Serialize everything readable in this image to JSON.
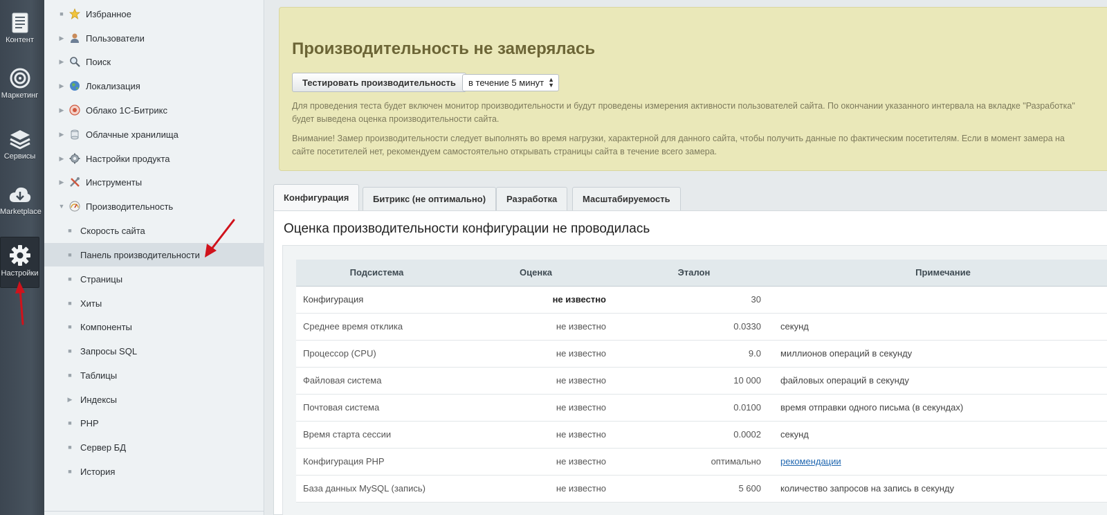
{
  "rail": {
    "items": [
      {
        "label": "Контент",
        "icon": "document-icon"
      },
      {
        "label": "Маркетинг",
        "icon": "target-icon"
      },
      {
        "label": "Сервисы",
        "icon": "layers-icon"
      },
      {
        "label": "Marketplace",
        "icon": "cloud-download-icon"
      },
      {
        "label": "Настройки",
        "icon": "gear-icon"
      }
    ]
  },
  "menu": {
    "items": [
      {
        "label": "Избранное",
        "icon": "star-icon",
        "bullet": "■"
      },
      {
        "label": "Пользователи",
        "icon": "user-icon",
        "bullet": "▶"
      },
      {
        "label": "Поиск",
        "icon": "magnifier-icon",
        "bullet": "▶"
      },
      {
        "label": "Локализация",
        "icon": "globe-icon",
        "bullet": "▶"
      },
      {
        "label": "Облако 1С-Битрикс",
        "icon": "cloud-bitrix-icon",
        "bullet": "▶"
      },
      {
        "label": "Облачные хранилища",
        "icon": "cloud-storage-icon",
        "bullet": "▶"
      },
      {
        "label": "Настройки продукта",
        "icon": "gear-small-icon",
        "bullet": "▶"
      },
      {
        "label": "Инструменты",
        "icon": "tools-icon",
        "bullet": "▶"
      },
      {
        "label": "Производительность",
        "icon": "speedometer-icon",
        "bullet": "▼"
      }
    ],
    "subitems": [
      {
        "label": "Скорость сайта",
        "bullet": "■"
      },
      {
        "label": "Панель производительности",
        "bullet": "■"
      },
      {
        "label": "Страницы",
        "bullet": "■"
      },
      {
        "label": "Хиты",
        "bullet": "■"
      },
      {
        "label": "Компоненты",
        "bullet": "■"
      },
      {
        "label": "Запросы SQL",
        "bullet": "■"
      },
      {
        "label": "Таблицы",
        "bullet": "■"
      },
      {
        "label": "Индексы",
        "bullet": "▶"
      },
      {
        "label": "PHP",
        "bullet": "■"
      },
      {
        "label": "Сервер БД",
        "bullet": "■"
      },
      {
        "label": "История",
        "bullet": "■"
      }
    ]
  },
  "alert": {
    "title": "Производительность не замерялась",
    "test_button": "Тестировать производительность",
    "period_value": "в течение 5 минут",
    "paragraph1_line1": "Для проведения теста будет включен монитор производительности и будут проведены измерения активности пользователей сайта. По окончании указанного интервала на вкладке \"Разработка\"",
    "paragraph1_line2": "будет выведена оценка производительности сайта.",
    "paragraph2_line1": "Внимание! Замер производительности следует выполнять во время нагрузки, характерной для данного сайта, чтобы получить данные по фактическим посетителям. Если в момент замера на",
    "paragraph2_line2": "сайте посетителей нет, рекомендуем самостоятельно открывать страницы сайта в течение всего замера."
  },
  "tabs": [
    {
      "label": "Конфигурация"
    },
    {
      "label": "Битрикс (не оптимально)"
    },
    {
      "label": "Разработка"
    },
    {
      "label": "Масштабируемость"
    }
  ],
  "panel": {
    "title": "Оценка производительности конфигурации не проводилась"
  },
  "table": {
    "headers": {
      "subsystem": "Подсистема",
      "score": "Оценка",
      "reference": "Эталон",
      "note": "Примечание"
    },
    "rows": [
      {
        "name": "Конфигурация",
        "score": "не известно",
        "ref": "30",
        "note": ""
      },
      {
        "name": "Среднее время отклика",
        "score": "не известно",
        "ref": "0.0330",
        "note": "секунд"
      },
      {
        "name": "Процессор (CPU)",
        "score": "не известно",
        "ref": "9.0",
        "note": "миллионов операций в секунду"
      },
      {
        "name": "Файловая система",
        "score": "не известно",
        "ref": "10 000",
        "note": "файловых операций в секунду"
      },
      {
        "name": "Почтовая система",
        "score": "не известно",
        "ref": "0.0100",
        "note": "время отправки одного письма (в секундах)"
      },
      {
        "name": "Время старта сессии",
        "score": "не известно",
        "ref": "0.0002",
        "note": "секунд"
      },
      {
        "name": "Конфигурация PHP",
        "score": "не известно",
        "ref": "оптимально",
        "note": "рекомендации"
      },
      {
        "name": "База данных MySQL (запись)",
        "score": "не известно",
        "ref": "5 600",
        "note": "количество запросов на запись в секунду"
      }
    ]
  },
  "colors": {
    "alert_bg": "#eae8b9",
    "alert_title": "#6c6536",
    "arrow": "#d0121b",
    "link": "#2067b0"
  }
}
